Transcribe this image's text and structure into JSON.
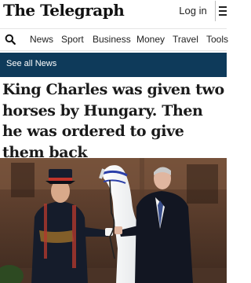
{
  "header": {
    "logo": "The Telegraph",
    "login_label": "Log in",
    "menu_icon": "hamburger-icon"
  },
  "nav": {
    "search_icon": "search-icon",
    "items": [
      "News",
      "Sport",
      "Business",
      "Money",
      "Travel",
      "Tools"
    ]
  },
  "section": {
    "link": "See all News"
  },
  "article": {
    "headline": "King Charles was given two horses by Hungary. Then he was ordered to give them back",
    "image_alt": "King Charles with a white horse and a military officer"
  }
}
